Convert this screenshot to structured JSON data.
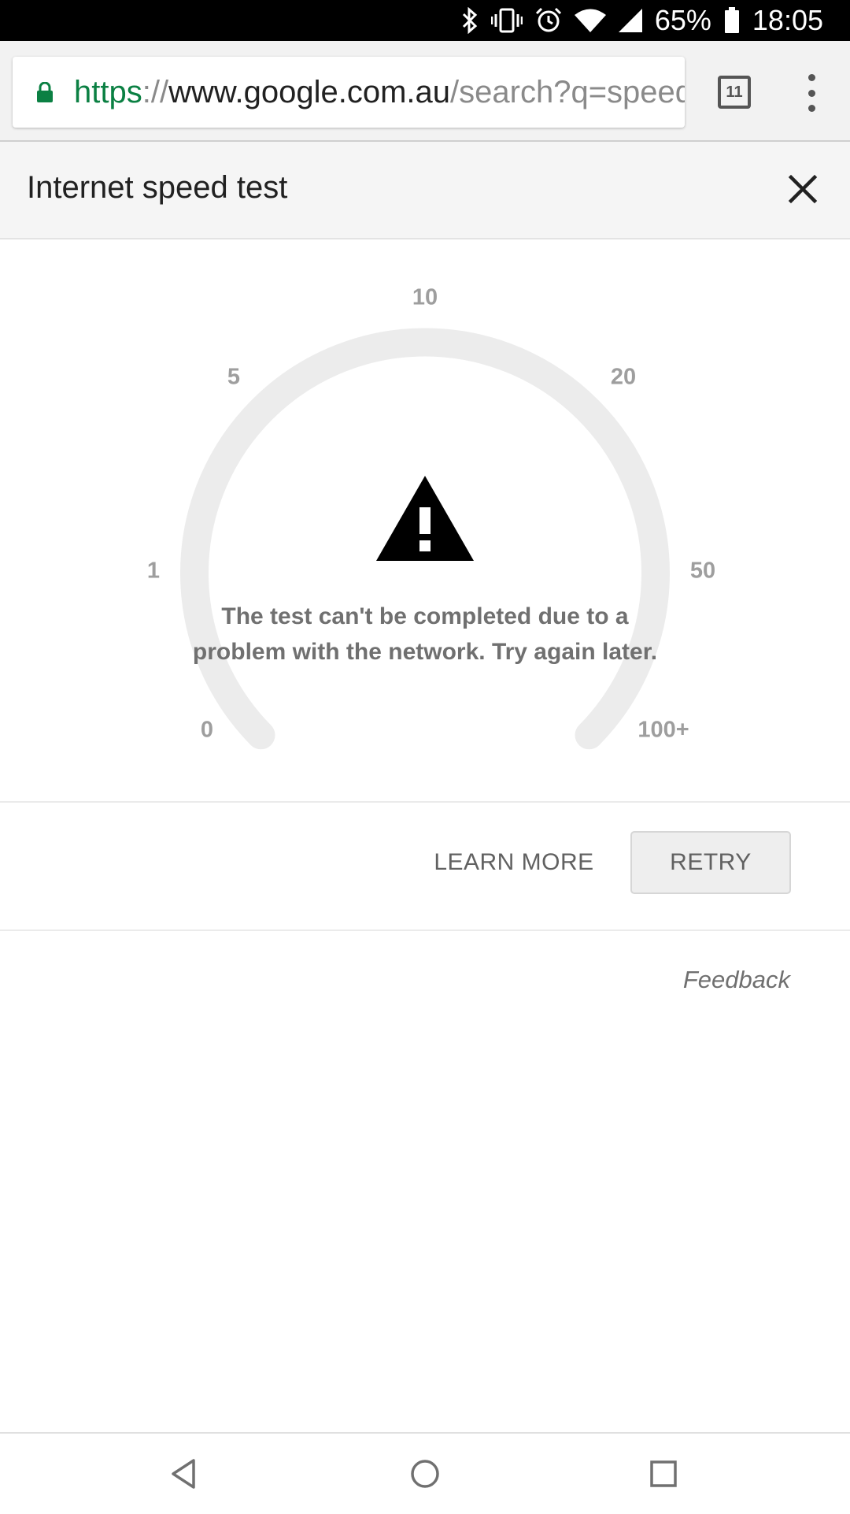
{
  "status_bar": {
    "battery": "65%",
    "time": "18:05"
  },
  "browser": {
    "url_scheme": "https",
    "url_separator": "://",
    "url_host": "www.google.com.au",
    "url_path": "/search?q=speed+test",
    "tab_count": "11"
  },
  "panel": {
    "title": "Internet speed test"
  },
  "gauge": {
    "tick_labels": [
      "0",
      "1",
      "5",
      "10",
      "20",
      "50",
      "100+"
    ],
    "error_message": "The test can't be completed due to a problem with the network. Try again later."
  },
  "actions": {
    "learn_more_label": "LEARN MORE",
    "retry_label": "RETRY"
  },
  "feedback_label": "Feedback",
  "icons": {
    "status": [
      "bluetooth-icon",
      "vibrate-icon",
      "alarm-icon",
      "wifi-icon",
      "signal-icon",
      "battery-icon"
    ],
    "browser": [
      "lock-icon",
      "tab-switcher-icon",
      "overflow-menu-icon"
    ],
    "panel": [
      "close-icon",
      "warning-icon"
    ],
    "nav": [
      "back-icon",
      "home-icon",
      "recents-icon"
    ]
  },
  "colors": {
    "secure_green": "#0b8043",
    "gauge_track": "#ececec",
    "muted_text": "#707070"
  }
}
